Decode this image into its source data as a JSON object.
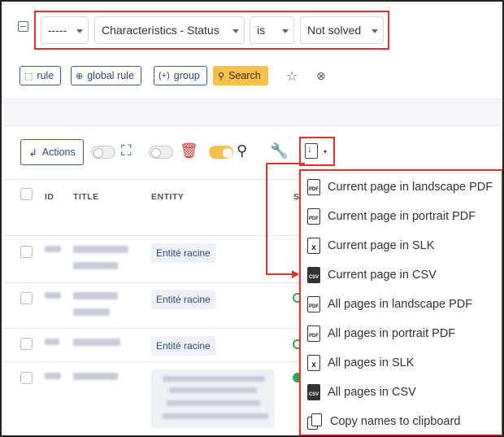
{
  "criteria": {
    "field1": "-----",
    "field2": "Characteristics - Status",
    "operator": "is",
    "value": "Not solved"
  },
  "search_buttons": {
    "rule": "rule",
    "global_rule": "global rule",
    "group": "group",
    "search": "Search"
  },
  "toolbar": {
    "actions": "Actions"
  },
  "table": {
    "headers": [
      "ID",
      "TITLE",
      "ENTITY",
      "S"
    ],
    "rows": [
      {
        "entity": "Entité racine"
      },
      {
        "entity": "Entité racine"
      },
      {
        "entity": "Entité racine"
      }
    ]
  },
  "export_menu": {
    "items": [
      {
        "label": "Current page in landscape PDF",
        "icon": "pdf-icon"
      },
      {
        "label": "Current page in portrait PDF",
        "icon": "pdf-icon"
      },
      {
        "label": "Current page in SLK",
        "icon": "slk-icon"
      },
      {
        "label": "Current page in CSV",
        "icon": "csv-icon"
      },
      {
        "label": "All pages in landscape PDF",
        "icon": "pdf-icon"
      },
      {
        "label": "All pages in portrait PDF",
        "icon": "pdf-icon"
      },
      {
        "label": "All pages in SLK",
        "icon": "slk-icon"
      },
      {
        "label": "All pages in CSV",
        "icon": "csv-icon"
      },
      {
        "label": "Copy names to clipboard",
        "icon": "copy-icon"
      }
    ]
  },
  "colors": {
    "highlight": "#e03030",
    "accent": "#f7c04a",
    "primary": "#2f4a7a"
  }
}
